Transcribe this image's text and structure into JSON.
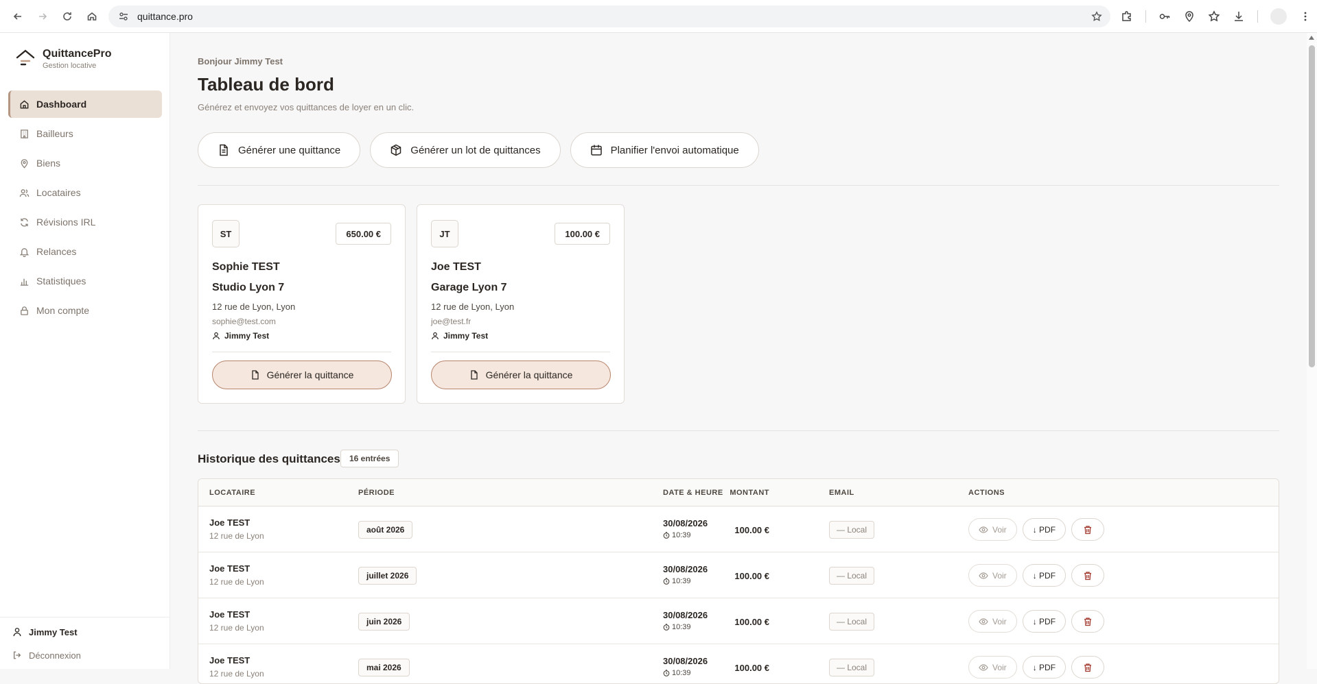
{
  "browser": {
    "url": "quittance.pro"
  },
  "brand": {
    "name": "QuittancePro",
    "subtitle": "Gestion locative"
  },
  "nav": {
    "items": [
      {
        "label": "Dashboard",
        "icon": "home-icon",
        "active": true
      },
      {
        "label": "Bailleurs",
        "icon": "building-icon"
      },
      {
        "label": "Biens",
        "icon": "map-pin-icon"
      },
      {
        "label": "Locataires",
        "icon": "users-icon"
      },
      {
        "label": "Révisions IRL",
        "icon": "refresh-icon"
      },
      {
        "label": "Relances",
        "icon": "bell-icon"
      },
      {
        "label": "Statistiques",
        "icon": "bar-chart-icon"
      },
      {
        "label": "Mon compte",
        "icon": "lock-icon"
      }
    ]
  },
  "user": {
    "name": "Jimmy Test",
    "logout": "Déconnexion"
  },
  "header": {
    "greeting": "Bonjour Jimmy Test",
    "title": "Tableau de bord",
    "subtitle": "Générez et envoyez vos quittances de loyer en un clic."
  },
  "actions": {
    "generate_one": "Générer une quittance",
    "generate_batch": "Générer un lot de quittances",
    "schedule": "Planifier l'envoi automatique"
  },
  "cards": [
    {
      "initials": "ST",
      "amount": "650.00 €",
      "tenant": "Sophie TEST",
      "property": "Studio Lyon 7",
      "address": "12 rue de Lyon, Lyon",
      "email": "sophie@test.com",
      "owner": "Jimmy Test",
      "button": "Générer la quittance"
    },
    {
      "initials": "JT",
      "amount": "100.00 €",
      "tenant": "Joe TEST",
      "property": "Garage Lyon 7",
      "address": "12 rue de Lyon, Lyon",
      "email": "joe@test.fr",
      "owner": "Jimmy Test",
      "button": "Générer la quittance"
    }
  ],
  "history": {
    "title": "Historique des quittances",
    "count": "16 entrées",
    "columns": {
      "tenant": "LOCATAIRE",
      "period": "PÉRIODE",
      "amount": "MONTANT",
      "datetime": "DATE & HEURE",
      "email": "EMAIL",
      "actions": "ACTIONS"
    },
    "rows": [
      {
        "tenant": "Joe TEST",
        "address": "12 rue de Lyon",
        "period": "août 2026",
        "amount": "100.00 €",
        "date": "30/08/2026",
        "time": "10:39",
        "email": "— Local",
        "view": "Voir",
        "pdf": "↓ PDF"
      },
      {
        "tenant": "Joe TEST",
        "address": "12 rue de Lyon",
        "period": "juillet 2026",
        "amount": "100.00 €",
        "date": "30/08/2026",
        "time": "10:39",
        "email": "— Local",
        "view": "Voir",
        "pdf": "↓ PDF"
      },
      {
        "tenant": "Joe TEST",
        "address": "12 rue de Lyon",
        "period": "juin 2026",
        "amount": "100.00 €",
        "date": "30/08/2026",
        "time": "10:39",
        "email": "— Local",
        "view": "Voir",
        "pdf": "↓ PDF"
      },
      {
        "tenant": "Joe TEST",
        "address": "12 rue de Lyon",
        "period": "mai 2026",
        "amount": "100.00 €",
        "date": "30/08/2026",
        "time": "10:39",
        "email": "— Local",
        "view": "Voir",
        "pdf": "↓ PDF"
      }
    ]
  },
  "colors": {
    "accent": "#b8846c",
    "accent_bg": "#f5e7de",
    "active_nav_bg": "#ebe0d6",
    "danger": "#a33a2f"
  }
}
